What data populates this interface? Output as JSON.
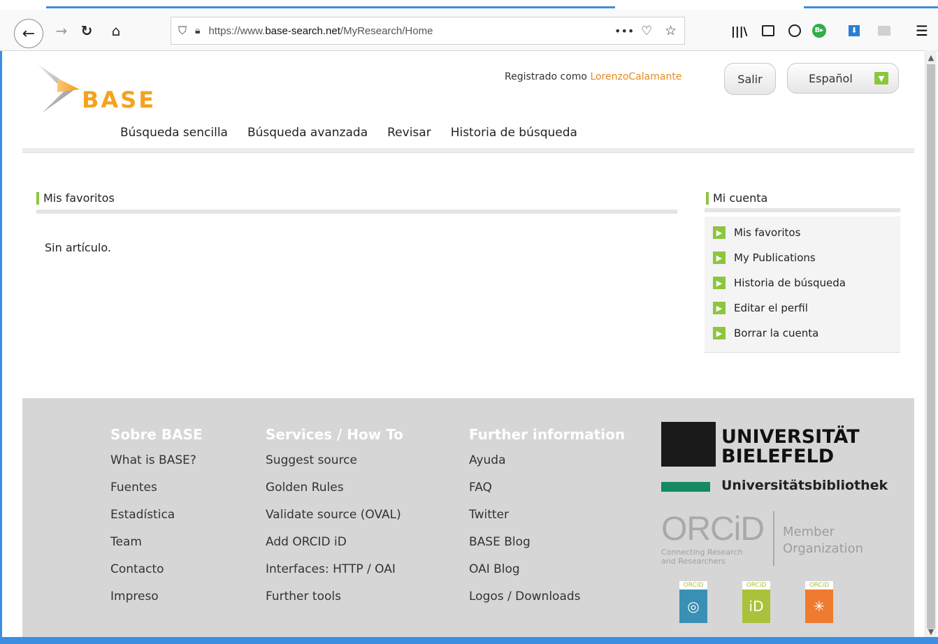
{
  "browser": {
    "url_prefix": "https://www.",
    "url_domain": "base-search.net",
    "url_path": "/MyResearch/Home"
  },
  "header": {
    "logo_text": "BASE",
    "logged_in_prefix": "Registrado como ",
    "username": "LorenzoCalamante",
    "logout_label": "Salir",
    "language_label": "Español"
  },
  "nav": {
    "items": [
      "Búsqueda sencilla",
      "Búsqueda avanzada",
      "Revisar",
      "Historia de búsqueda"
    ]
  },
  "favorites": {
    "title": "Mis favoritos",
    "empty_text": "Sin artículo."
  },
  "account": {
    "title": "Mi cuenta",
    "items": [
      "Mis favoritos",
      "My Publications",
      "Historia de búsqueda",
      "Editar el perfil",
      "Borrar la cuenta"
    ]
  },
  "footer": {
    "columns": [
      {
        "heading": "Sobre BASE",
        "links": [
          "What is BASE?",
          "Fuentes",
          "Estadística",
          "Team",
          "Contacto",
          "Impreso"
        ]
      },
      {
        "heading": "Services / How To",
        "links": [
          "Suggest source",
          "Golden Rules",
          "Validate source (OVAL)",
          "Add ORCID iD",
          "Interfaces: HTTP / OAI",
          "Further tools"
        ]
      },
      {
        "heading": "Further information",
        "links": [
          "Ayuda",
          "FAQ",
          "Twitter",
          "BASE Blog",
          "OAI Blog",
          "Logos / Downloads"
        ]
      }
    ],
    "university_line1": "UNIVERSITÄT",
    "university_line2": "BIELEFELD",
    "library": "Universitätsbibliothek",
    "orcid_logo": "ORCiD",
    "orcid_tagline1": "Connecting Research",
    "orcid_tagline2": "and Researchers",
    "orcid_member1": "Member",
    "orcid_member2": "Organization",
    "badge_label": "ORCiD"
  }
}
